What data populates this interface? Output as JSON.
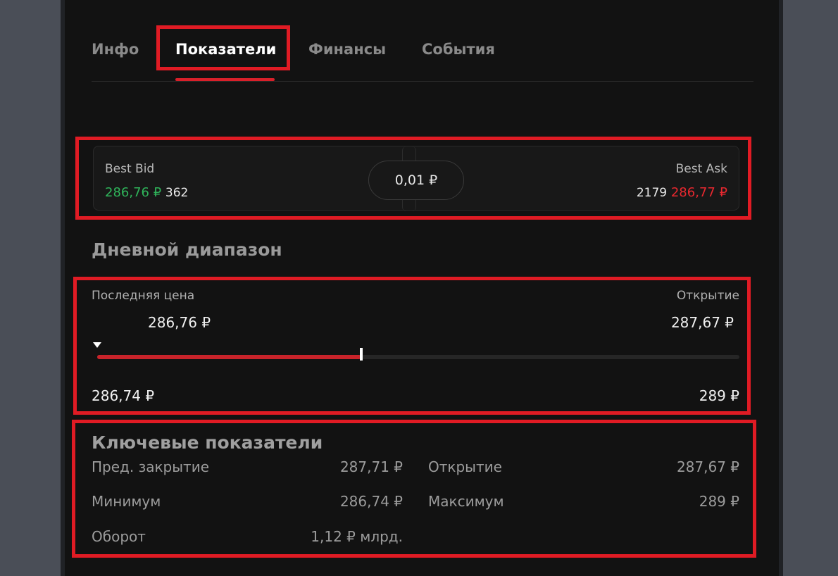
{
  "tabs": [
    {
      "label": "Инфо"
    },
    {
      "label": "Показатели"
    },
    {
      "label": "Финансы"
    },
    {
      "label": "События"
    }
  ],
  "best": {
    "bid_title": "Best Bid",
    "bid_price": "286,76 ₽",
    "bid_volume": "362",
    "spread": "0,01 ₽",
    "ask_title": "Best Ask",
    "ask_volume": "2179",
    "ask_price": "286,77 ₽"
  },
  "day_range": {
    "title": "Дневной диапазон",
    "last_label": "Последняя цена",
    "last_value": "286,76 ₽",
    "open_label": "Открытие",
    "open_value": "287,67 ₽",
    "min_value": "286,74 ₽",
    "max_value": "289 ₽",
    "min_num": 286.74,
    "max_num": 289,
    "last_num": 286.76,
    "open_num": 287.67
  },
  "key_metrics": {
    "title": "Ключевые показатели",
    "items": [
      {
        "label": "Пред. закрытие",
        "value": "287,71 ₽"
      },
      {
        "label": "Открытие",
        "value": "287,67 ₽"
      },
      {
        "label": "Минимум",
        "value": "286,74 ₽"
      },
      {
        "label": "Максимум",
        "value": "289 ₽"
      },
      {
        "label": "Оборот",
        "value": "1,12 ₽ млрд."
      }
    ]
  },
  "colors": {
    "accent": "#d9202a",
    "bid": "#2fb45a",
    "ask": "#e8282f",
    "background": "#121212"
  }
}
